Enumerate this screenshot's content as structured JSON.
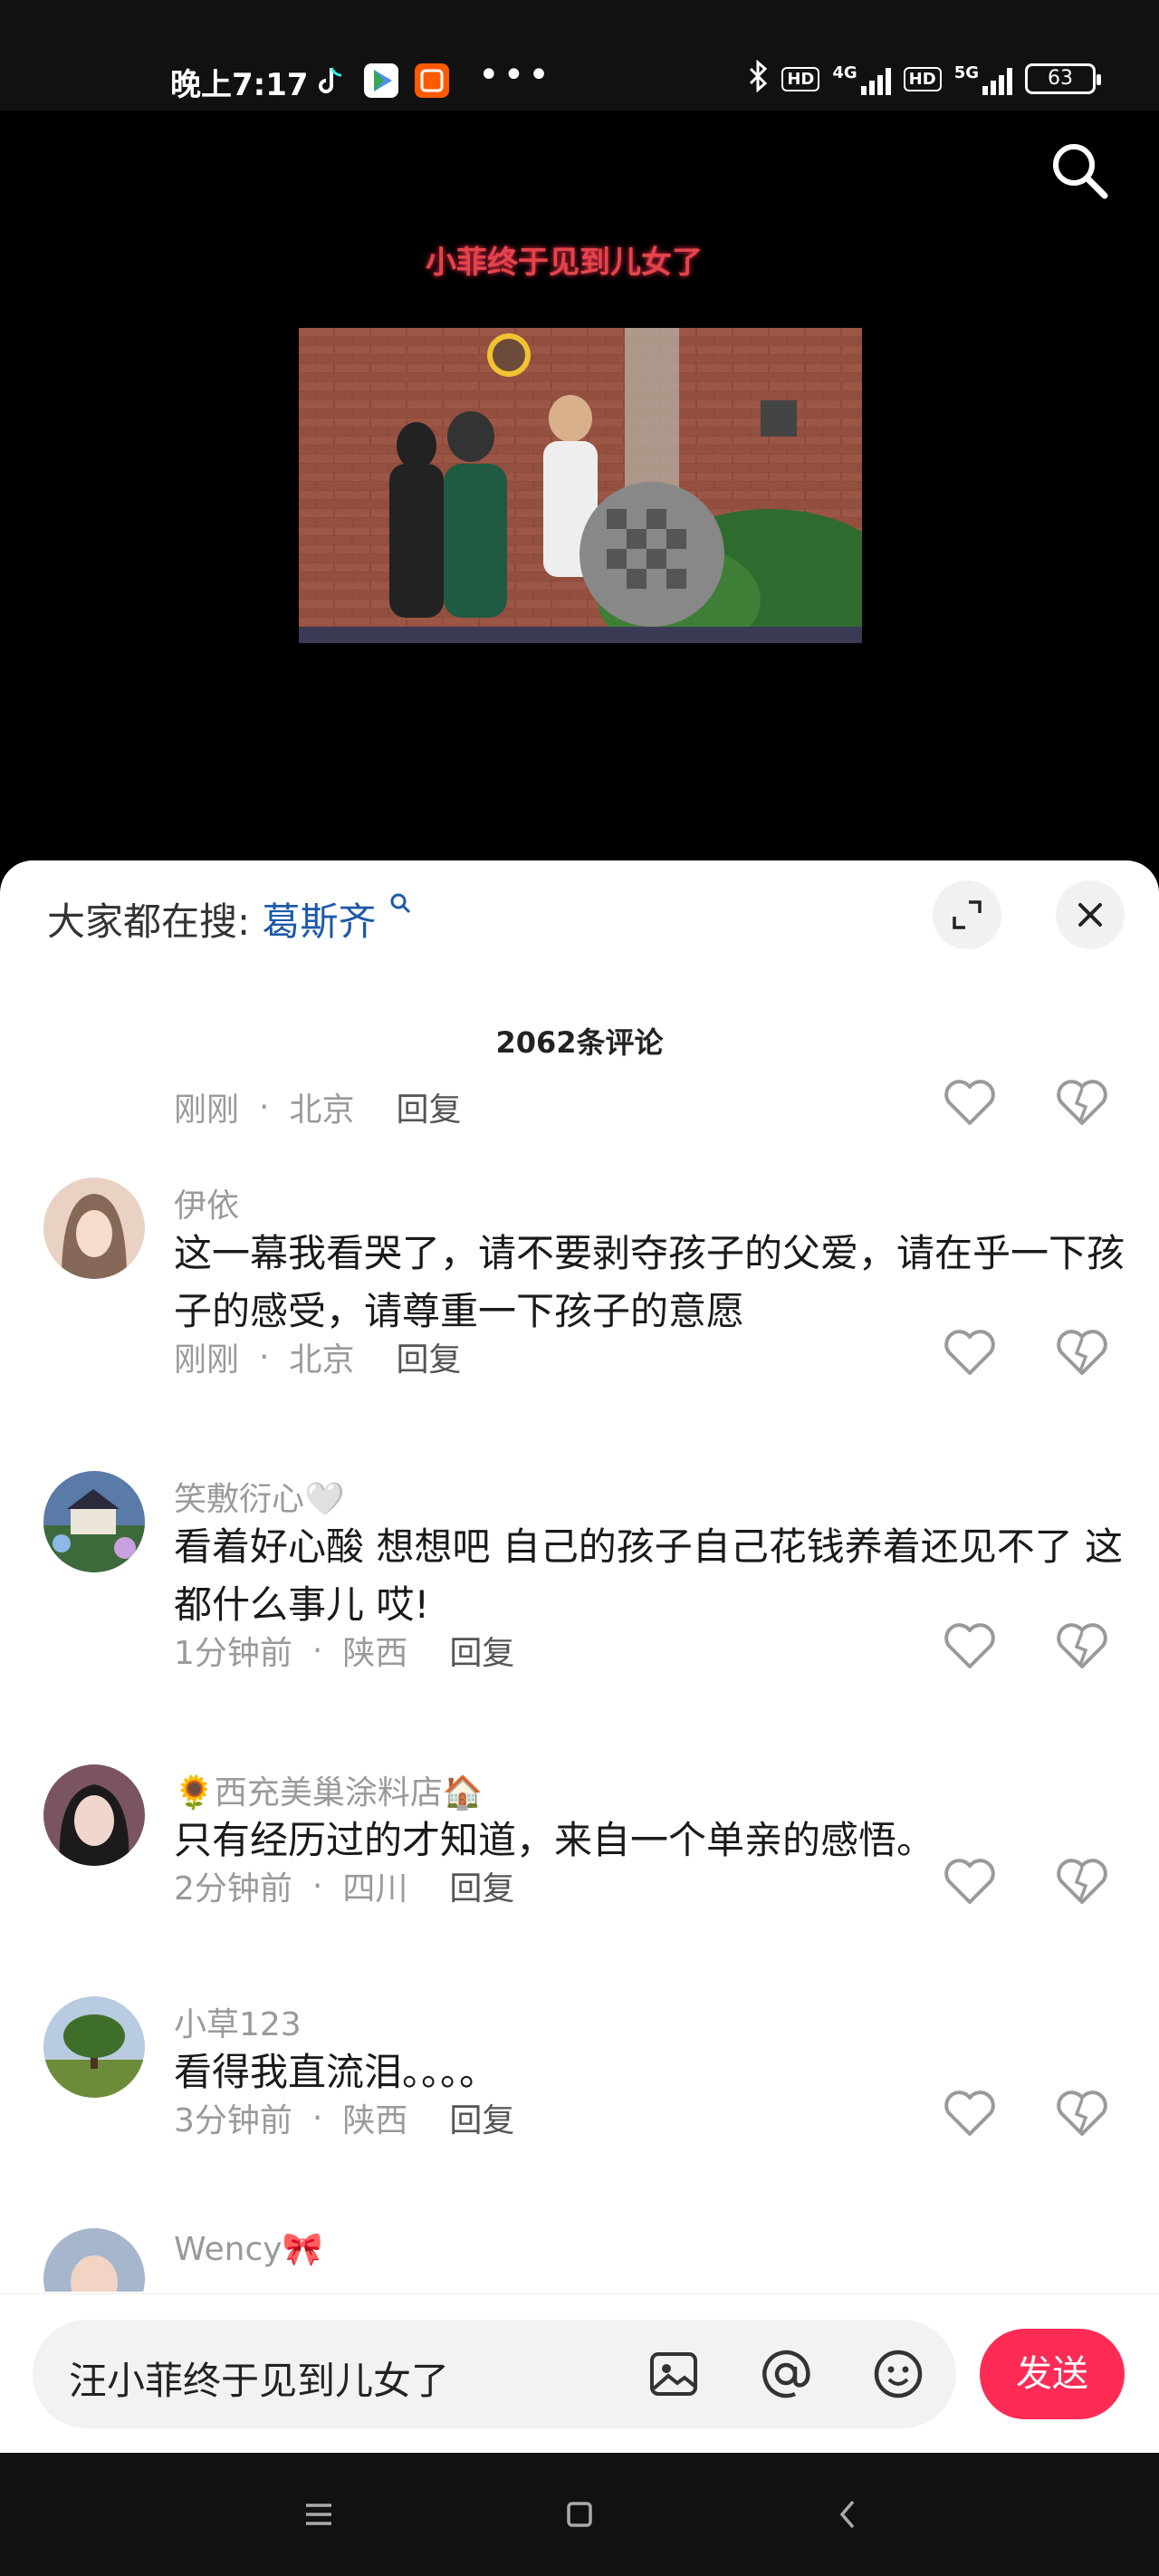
{
  "status_bar": {
    "time": "晚上7:17",
    "dots": "•••",
    "network_1": "4G",
    "network_2": "5G",
    "hd_1": "HD",
    "hd_2": "HD",
    "battery": "63",
    "icons": [
      "tiktok-icon",
      "play-store-icon",
      "taobao-icon"
    ]
  },
  "video": {
    "caption": "小菲终于见到儿女了",
    "search_icon": "search-icon"
  },
  "sheet": {
    "search_prefix": "大家都在搜:",
    "search_term": "葛斯齐",
    "comment_count": "2062条评论"
  },
  "comments": [
    {
      "name": "",
      "text": "",
      "time": "刚刚",
      "location": "北京",
      "reply": "回复"
    },
    {
      "name": "伊依",
      "text": "这一幕我看哭了，请不要剥夺孩子的父爱，请在乎一下孩子的感受，请尊重一下孩子的意愿",
      "time": "刚刚",
      "location": "北京",
      "reply": "回复"
    },
    {
      "name": "笑敷衍心🤍",
      "text": "看着好心酸  想想吧 自己的孩子自己花钱养着还见不了 这都什么事儿 哎!",
      "time": "1分钟前",
      "location": "陕西",
      "reply": "回复"
    },
    {
      "name": "🌻西充美巢涂料店🏠",
      "text": "只有经历过的才知道，来自一个单亲的感悟。",
      "time": "2分钟前",
      "location": "四川",
      "reply": "回复"
    },
    {
      "name": "小草123",
      "text": "看得我直流泪。。。。",
      "time": "3分钟前",
      "location": "陕西",
      "reply": "回复"
    },
    {
      "name": "Wency🎀",
      "text": "",
      "time": "",
      "location": "",
      "reply": ""
    }
  ],
  "input": {
    "value": "汪小菲终于见到儿女了",
    "send_label": "发送"
  },
  "colors": {
    "accent": "#fe2c55",
    "search_term": "#1c5aa8"
  }
}
